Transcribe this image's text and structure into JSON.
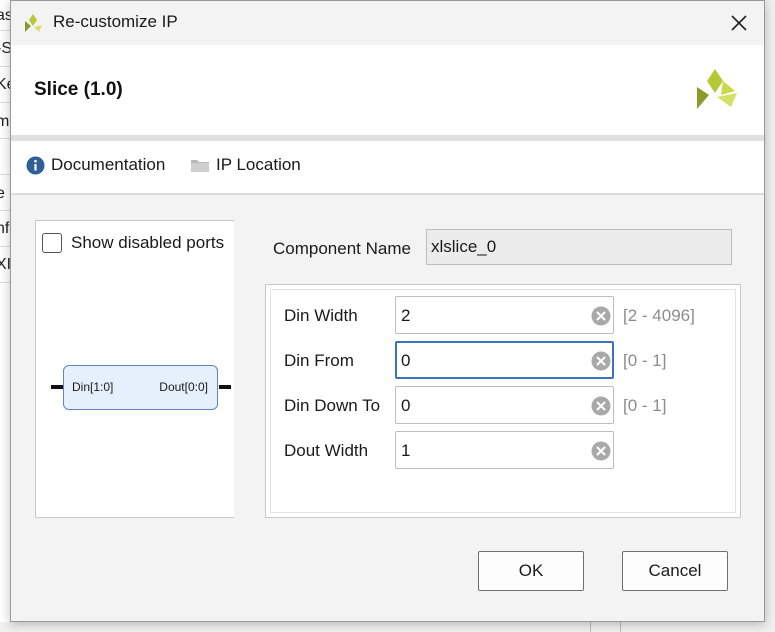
{
  "background": {
    "left_fragments": [
      "as",
      "-S",
      "Ke",
      "m",
      "e",
      "nf",
      "XI"
    ]
  },
  "window": {
    "title": "Re-customize IP"
  },
  "header": {
    "ip_title": "Slice (1.0)"
  },
  "toolbar": {
    "documentation_label": "Documentation",
    "ip_location_label": "IP Location"
  },
  "preview": {
    "show_disabled_ports_label": "Show disabled ports",
    "show_disabled_ports_checked": false,
    "port_in": "Din[1:0]",
    "port_out": "Dout[0:0]"
  },
  "component": {
    "label": "Component Name",
    "value": "xlslice_0"
  },
  "params": [
    {
      "label": "Din Width",
      "value": "2",
      "range": "[2 - 4096]",
      "focused": false
    },
    {
      "label": "Din From",
      "value": "0",
      "range": "[0 - 1]",
      "focused": true
    },
    {
      "label": "Din Down To",
      "value": "0",
      "range": "[0 - 1]",
      "focused": false
    },
    {
      "label": "Dout Width",
      "value": "1",
      "range": "",
      "focused": false
    }
  ],
  "buttons": {
    "ok": "OK",
    "cancel": "Cancel"
  },
  "colors": {
    "accent_focus": "#3d73c4",
    "symbol_fill": "#e6f0fb",
    "symbol_border": "#5b87c2",
    "logo_green": "#b5c935",
    "info_icon": "#2f5f96"
  },
  "icons": {
    "app": "xilinx-logo-icon",
    "close": "close-icon",
    "doc": "info-icon",
    "location": "folder-icon",
    "clear": "clear-circle-x-icon"
  }
}
